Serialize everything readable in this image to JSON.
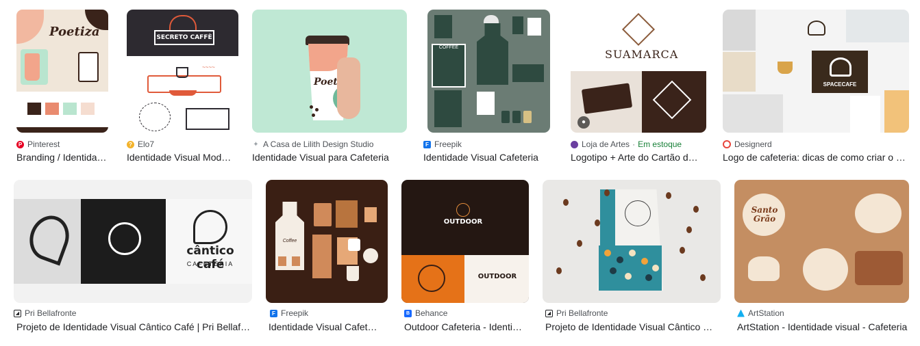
{
  "results": [
    {
      "source": "Pinterest",
      "title": "Branding / Identidade Visual",
      "thumb_text": "Poetiza",
      "colors": {
        "fav": "#e60023"
      }
    },
    {
      "source": "Elo7",
      "title": "Identidade Visual Moderna",
      "thumb_text": "SECRETO CAFFÈ",
      "colors": {
        "fav": "#f3b32b"
      }
    },
    {
      "source": "A Casa de Lilith Design Studio",
      "title": "Identidade Visual para Cafeteria",
      "thumb_text": "Poetiza",
      "colors": {
        "fav": "#9aa0a6"
      }
    },
    {
      "source": "Freepik",
      "title": "Identidade Visual Cafeteria",
      "thumb_text": "COFFEE",
      "colors": {
        "fav": "#1273eb"
      }
    },
    {
      "source": "Loja de Artes",
      "stock": "Em estoque",
      "title": "Logotipo + Arte do Cartão de Visita",
      "thumb_text": "SUAMARCA",
      "colors": {
        "fav": "#6b3fa0"
      }
    },
    {
      "source": "Designerd",
      "title": "Logo de cafeteria: dicas de como criar o seu",
      "thumb_text": "SPACECAFE",
      "colors": {
        "fav": "#e8453c"
      }
    },
    {
      "source": "Pri Bellafronte",
      "title": "Projeto de Identidade Visual Cântico Café | Pri Bellafronte",
      "thumb_text": "cântico café",
      "thumb_sub": "CAFETERIA",
      "colors": {
        "fav": "#202124"
      }
    },
    {
      "source": "Freepik",
      "title": "Identidade Visual Cafeteria",
      "thumb_text": "Coffee",
      "colors": {
        "fav": "#1273eb"
      }
    },
    {
      "source": "Behance",
      "title": "Outdoor Cafeteria - Identidade Visual",
      "thumb_text": "OUTDOOR",
      "colors": {
        "fav": "#1769ff"
      }
    },
    {
      "source": "Pri Bellafronte",
      "title": "Projeto de Identidade Visual Cântico Café",
      "thumb_text": "",
      "colors": {
        "fav": "#202124"
      }
    },
    {
      "source": "ArtStation",
      "title": "ArtStation - Identidade visual - Cafeteria",
      "thumb_text": "Santo Grão",
      "colors": {
        "fav": "#13aff0"
      }
    }
  ]
}
